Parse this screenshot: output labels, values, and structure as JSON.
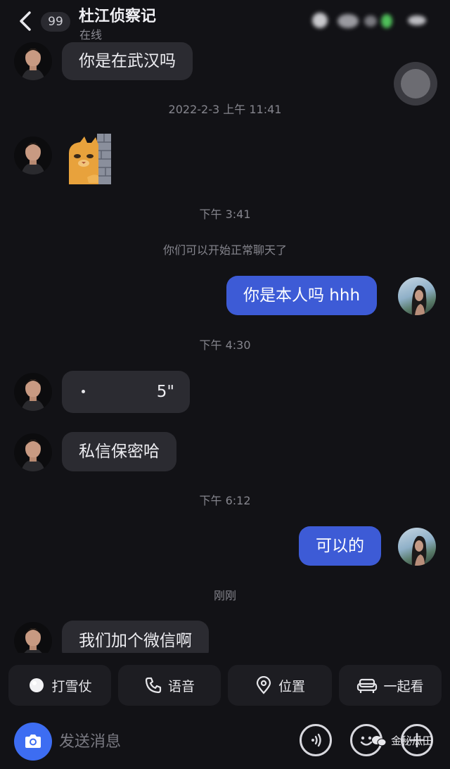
{
  "header": {
    "unread_count": "99",
    "title": "杜江侦察记",
    "status": "在线"
  },
  "messages": [
    {
      "type": "in",
      "text": "你是在武汉吗"
    },
    {
      "type": "time",
      "text": "2022-2-3 上午 11:41"
    },
    {
      "type": "in-sticker",
      "sticker": "cat-peeking-from-wall"
    },
    {
      "type": "time",
      "text": "下午 3:41"
    },
    {
      "type": "system",
      "text": "你们可以开始正常聊天了"
    },
    {
      "type": "out",
      "text": "你是本人吗 hhh"
    },
    {
      "type": "time",
      "text": "下午 4:30"
    },
    {
      "type": "in-voice",
      "duration": "5\""
    },
    {
      "type": "in",
      "text": "私信保密哈"
    },
    {
      "type": "time",
      "text": "下午 6:12"
    },
    {
      "type": "out",
      "text": "可以的"
    },
    {
      "type": "time",
      "text": "刚刚"
    },
    {
      "type": "in",
      "text": "我们加个微信啊"
    }
  ],
  "quick_actions": [
    {
      "label": "打雪仗",
      "icon": "snowball-icon"
    },
    {
      "label": "语音",
      "icon": "phone-icon"
    },
    {
      "label": "位置",
      "icon": "location-pin-icon"
    },
    {
      "label": "一起看",
      "icon": "sofa-icon"
    }
  ],
  "input": {
    "placeholder": "发送消息"
  },
  "watermark": "金秘瓜田",
  "colors": {
    "background": "#121216",
    "incoming_bubble": "#2b2b31",
    "outgoing_bubble": "#3d5bd6",
    "camera_button": "#3d6df2"
  }
}
